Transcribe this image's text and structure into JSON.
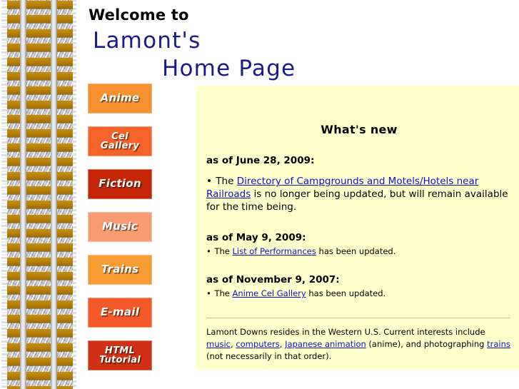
{
  "header": {
    "welcome": "Welcome to",
    "title_line_1": "Lamont's",
    "title_line_2": "Home Page"
  },
  "nav": {
    "buttons": [
      {
        "label": "Anime",
        "color": "#f5912e"
      },
      {
        "label": "Cel\nGallery",
        "color": "#f4632a"
      },
      {
        "label": "Fiction",
        "color": "#c62608"
      },
      {
        "label": "Music",
        "color": "#fa9c72"
      },
      {
        "label": "Trains",
        "color": "#f79b32"
      },
      {
        "label": "E-mail",
        "color": "#f4592a"
      },
      {
        "label": "HTML\nTutorial",
        "color": "#cf3112"
      }
    ]
  },
  "content": {
    "heading": "What's new",
    "updates": [
      {
        "date": "as of June 28, 2009:",
        "bullet": "• ",
        "pre_link": "The ",
        "link": "Directory of Campgrounds and Motels/Hotels near Railroads",
        "post_link": " is no longer being updated, but will remain available for the time being."
      },
      {
        "date": "as of May 9, 2009:",
        "bullet": "• ",
        "pre_link": "The ",
        "link": "List of Performances",
        "post_link": " has been updated."
      },
      {
        "date": "as of November 9, 2007:",
        "bullet": "• ",
        "pre_link": "The ",
        "link": "Anime Cel Gallery",
        "post_link": " has been updated."
      }
    ],
    "bio": {
      "part_1": "Lamont Downs resides in the Western U.S. Current interests include ",
      "link_music": "music",
      "part_2": ", ",
      "link_computers": "computers",
      "part_3": ", ",
      "link_japanese_animation": "Japanese animation",
      "part_4": " (anime), and photographing ",
      "link_trains": "trains",
      "part_5": " (not necessarily in that order)."
    }
  },
  "decor": {
    "track_alt": "railroad-track-border",
    "ballast_color": "#b9b9b9",
    "tie_color": "#b9820a",
    "rail_color": "#e8e8e8",
    "panel_color": "#ffffcc",
    "link_color": "#1111cc",
    "title_color": "#1a1a8c"
  }
}
